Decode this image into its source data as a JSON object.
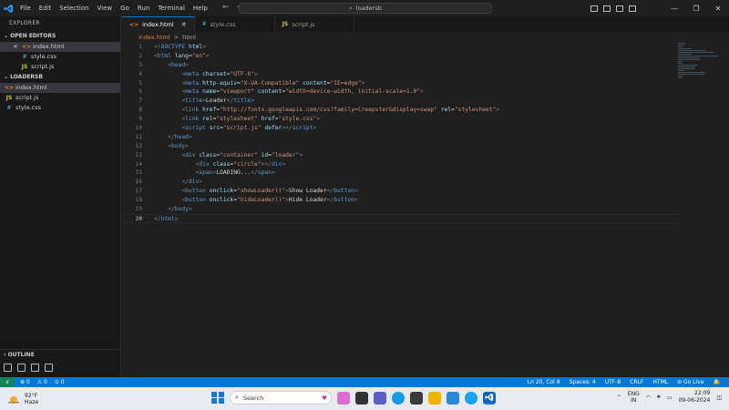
{
  "window": {
    "menu": [
      "File",
      "Edit",
      "Selection",
      "View",
      "Go",
      "Run",
      "Terminal",
      "Help"
    ],
    "search_text": "loadersb"
  },
  "sidebar": {
    "title": "EXPLORER",
    "open_editors_label": "OPEN EDITORS",
    "open_editors": [
      {
        "name": "index.html",
        "type": "html",
        "close": "✕"
      },
      {
        "name": "style.css",
        "type": "css"
      },
      {
        "name": "script.js",
        "type": "js"
      }
    ],
    "folder_label": "LOADERSB",
    "files": [
      {
        "name": "index.html",
        "type": "html"
      },
      {
        "name": "script.js",
        "type": "js"
      },
      {
        "name": "style.css",
        "type": "css"
      }
    ],
    "outline_label": "OUTLINE"
  },
  "tabs": [
    {
      "label": "index.html",
      "type": "html",
      "active": true
    },
    {
      "label": "style.css",
      "type": "css"
    },
    {
      "label": "script.js",
      "type": "js"
    }
  ],
  "breadcrumb": [
    "index.html",
    ">",
    "html"
  ],
  "editor": {
    "current_line": 20,
    "lines": [
      [
        [
          "br",
          "<!"
        ],
        [
          "tag",
          "DOCTYPE"
        ],
        [
          "txt",
          " "
        ],
        [
          "attr",
          "html"
        ],
        [
          "br",
          ">"
        ]
      ],
      [
        [
          "br",
          "<"
        ],
        [
          "tag",
          "html"
        ],
        [
          "txt",
          " "
        ],
        [
          "attr",
          "lang"
        ],
        [
          "txt",
          "="
        ],
        [
          "str",
          "\"en\""
        ],
        [
          "br",
          ">"
        ]
      ],
      [
        [
          "txt",
          "    "
        ],
        [
          "br",
          "<"
        ],
        [
          "tag",
          "head"
        ],
        [
          "br",
          ">"
        ]
      ],
      [
        [
          "txt",
          "        "
        ],
        [
          "br",
          "<"
        ],
        [
          "tag",
          "meta"
        ],
        [
          "txt",
          " "
        ],
        [
          "attr",
          "charset"
        ],
        [
          "txt",
          "="
        ],
        [
          "str",
          "\"UTF-8\""
        ],
        [
          "br",
          ">"
        ]
      ],
      [
        [
          "txt",
          "        "
        ],
        [
          "br",
          "<"
        ],
        [
          "tag",
          "meta"
        ],
        [
          "txt",
          " "
        ],
        [
          "attr",
          "http-equiv"
        ],
        [
          "txt",
          "="
        ],
        [
          "str",
          "\"X-UA-Compatible\""
        ],
        [
          "txt",
          " "
        ],
        [
          "attr",
          "content"
        ],
        [
          "txt",
          "="
        ],
        [
          "str",
          "\"IE=edge\""
        ],
        [
          "br",
          ">"
        ]
      ],
      [
        [
          "txt",
          "        "
        ],
        [
          "br",
          "<"
        ],
        [
          "tag",
          "meta"
        ],
        [
          "txt",
          " "
        ],
        [
          "attr",
          "name"
        ],
        [
          "txt",
          "="
        ],
        [
          "str",
          "\"viewport\""
        ],
        [
          "txt",
          " "
        ],
        [
          "attr",
          "content"
        ],
        [
          "txt",
          "="
        ],
        [
          "str",
          "\"width=device-width, initial-scale=1.0\""
        ],
        [
          "br",
          ">"
        ]
      ],
      [
        [
          "txt",
          "        "
        ],
        [
          "br",
          "<"
        ],
        [
          "tag",
          "title"
        ],
        [
          "br",
          ">"
        ],
        [
          "txt",
          "Loader"
        ],
        [
          "br",
          "</"
        ],
        [
          "tag",
          "title"
        ],
        [
          "br",
          ">"
        ]
      ],
      [
        [
          "txt",
          "        "
        ],
        [
          "br",
          "<"
        ],
        [
          "tag",
          "link"
        ],
        [
          "txt",
          " "
        ],
        [
          "attr",
          "href"
        ],
        [
          "txt",
          "="
        ],
        [
          "str",
          "\"http://fonts.googleapis.com/css?family=Creepster&display=swap\""
        ],
        [
          "txt",
          " "
        ],
        [
          "attr",
          "rel"
        ],
        [
          "txt",
          "="
        ],
        [
          "str",
          "\"stylesheet\""
        ],
        [
          "br",
          ">"
        ]
      ],
      [
        [
          "txt",
          "        "
        ],
        [
          "br",
          "<"
        ],
        [
          "tag",
          "link"
        ],
        [
          "txt",
          " "
        ],
        [
          "attr",
          "rel"
        ],
        [
          "txt",
          "="
        ],
        [
          "str",
          "\"stylesheet\""
        ],
        [
          "txt",
          " "
        ],
        [
          "attr",
          "href"
        ],
        [
          "txt",
          "="
        ],
        [
          "str",
          "\"style.css\""
        ],
        [
          "br",
          ">"
        ]
      ],
      [
        [
          "txt",
          "        "
        ],
        [
          "br",
          "<"
        ],
        [
          "tag",
          "script"
        ],
        [
          "txt",
          " "
        ],
        [
          "attr",
          "src"
        ],
        [
          "txt",
          "="
        ],
        [
          "str",
          "\"script.js\""
        ],
        [
          "txt",
          " "
        ],
        [
          "attr",
          "defer"
        ],
        [
          "br",
          "></"
        ],
        [
          "tag",
          "script"
        ],
        [
          "br",
          ">"
        ]
      ],
      [
        [
          "txt",
          "    "
        ],
        [
          "br",
          "</"
        ],
        [
          "tag",
          "head"
        ],
        [
          "br",
          ">"
        ]
      ],
      [
        [
          "txt",
          "    "
        ],
        [
          "br",
          "<"
        ],
        [
          "tag",
          "body"
        ],
        [
          "br",
          ">"
        ]
      ],
      [
        [
          "txt",
          "        "
        ],
        [
          "br",
          "<"
        ],
        [
          "tag",
          "div"
        ],
        [
          "txt",
          " "
        ],
        [
          "attr",
          "class"
        ],
        [
          "txt",
          "="
        ],
        [
          "str",
          "\"container\""
        ],
        [
          "txt",
          " "
        ],
        [
          "attr",
          "id"
        ],
        [
          "txt",
          "="
        ],
        [
          "str",
          "\"loader\""
        ],
        [
          "br",
          ">"
        ]
      ],
      [
        [
          "txt",
          "            "
        ],
        [
          "br",
          "<"
        ],
        [
          "tag",
          "div"
        ],
        [
          "txt",
          " "
        ],
        [
          "attr",
          "class"
        ],
        [
          "txt",
          "="
        ],
        [
          "str",
          "\"circle\""
        ],
        [
          "br",
          "></"
        ],
        [
          "tag",
          "div"
        ],
        [
          "br",
          ">"
        ]
      ],
      [
        [
          "txt",
          "            "
        ],
        [
          "br",
          "<"
        ],
        [
          "tag",
          "span"
        ],
        [
          "br",
          ">"
        ],
        [
          "txt",
          "LOADING..."
        ],
        [
          "br",
          "</"
        ],
        [
          "tag",
          "span"
        ],
        [
          "br",
          ">"
        ]
      ],
      [
        [
          "txt",
          "        "
        ],
        [
          "br",
          "</"
        ],
        [
          "tag",
          "div"
        ],
        [
          "br",
          ">"
        ]
      ],
      [
        [
          "txt",
          "        "
        ],
        [
          "br",
          "<"
        ],
        [
          "tag",
          "button"
        ],
        [
          "txt",
          " "
        ],
        [
          "attr",
          "onclick"
        ],
        [
          "txt",
          "="
        ],
        [
          "str",
          "\"showLoader()\""
        ],
        [
          "br",
          ">"
        ],
        [
          "txt",
          "Show Loader"
        ],
        [
          "br",
          "</"
        ],
        [
          "tag",
          "button"
        ],
        [
          "br",
          ">"
        ]
      ],
      [
        [
          "txt",
          "        "
        ],
        [
          "br",
          "<"
        ],
        [
          "tag",
          "button"
        ],
        [
          "txt",
          " "
        ],
        [
          "attr",
          "onclick"
        ],
        [
          "txt",
          "="
        ],
        [
          "str",
          "\"hideLoader()\""
        ],
        [
          "br",
          ">"
        ],
        [
          "txt",
          "Hide Loader"
        ],
        [
          "br",
          "</"
        ],
        [
          "tag",
          "button"
        ],
        [
          "br",
          ">"
        ]
      ],
      [
        [
          "txt",
          "    "
        ],
        [
          "br",
          "</"
        ],
        [
          "tag",
          "body"
        ],
        [
          "br",
          ">"
        ]
      ],
      [
        [
          "br",
          "</"
        ],
        [
          "tag",
          "html"
        ],
        [
          "br",
          ">"
        ]
      ]
    ]
  },
  "statusbar": {
    "remote_icon": "⚡",
    "errors": "⊗ 0",
    "warnings": "⚠ 0",
    "ports": "⊙ 0",
    "position": "Ln 20, Col 8",
    "spaces": "Spaces: 4",
    "encoding": "UTF-8",
    "eol": "CRLF",
    "language": "HTML",
    "golive": "⊘ Go Live",
    "bell": "🔔"
  },
  "taskbar": {
    "temp": "92°F",
    "condition": "Haze",
    "search_label": "Search",
    "lang_top": "ENG",
    "lang_bottom": "IN",
    "time": "22:09",
    "date": "09-06-2024"
  },
  "colors": {
    "statusbar": "#0078d4",
    "html_icon": "#e37933",
    "css_icon": "#519aba",
    "js_icon": "#cbcb41"
  }
}
